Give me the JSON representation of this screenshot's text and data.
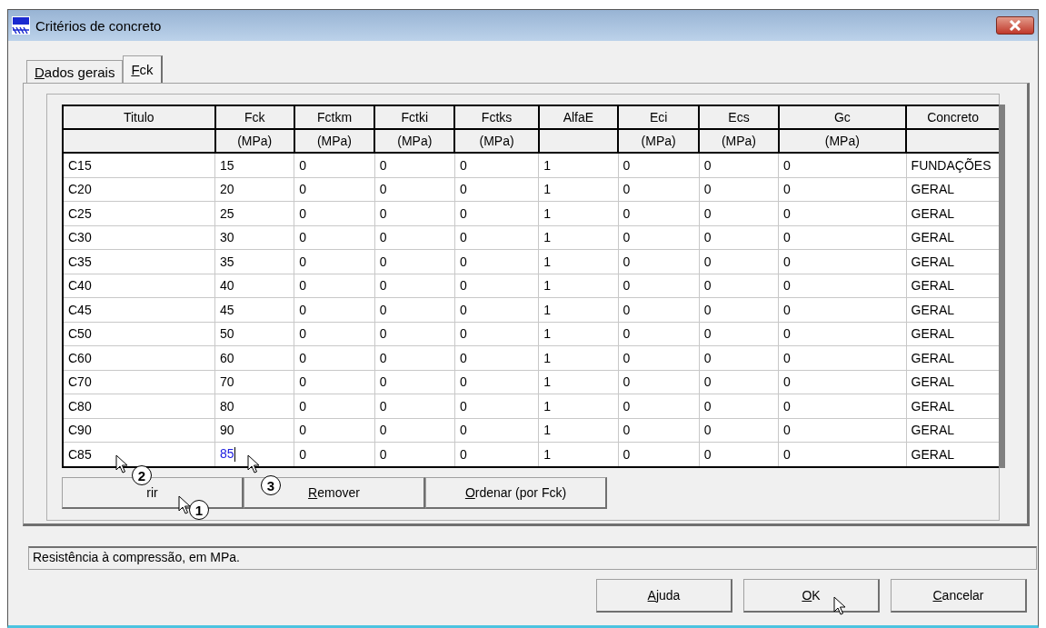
{
  "window": {
    "title": "Critérios de concreto"
  },
  "tabs": [
    {
      "label": "Dados gerais",
      "mnemonic": true,
      "selected": false
    },
    {
      "label": "Fck",
      "mnemonic": true,
      "selected": true
    }
  ],
  "table": {
    "columns": [
      {
        "title": "Titulo"
      },
      {
        "title": "Fck",
        "unit": "(MPa)"
      },
      {
        "title": "Fctkm",
        "unit": "(MPa)"
      },
      {
        "title": "Fctki",
        "unit": "(MPa)"
      },
      {
        "title": "Fctks",
        "unit": "(MPa)"
      },
      {
        "title": "AlfaE"
      },
      {
        "title": "Eci",
        "unit": "(MPa)"
      },
      {
        "title": "Ecs",
        "unit": "(MPa)"
      },
      {
        "title": "Gc",
        "unit": "(MPa)"
      },
      {
        "title": "Concreto"
      }
    ],
    "rows": [
      {
        "cells": [
          "C15",
          "15",
          "0",
          "0",
          "0",
          "1",
          "0",
          "0",
          "0",
          "FUNDAÇÕES"
        ],
        "editing": false
      },
      {
        "cells": [
          "C20",
          "20",
          "0",
          "0",
          "0",
          "1",
          "0",
          "0",
          "0",
          "GERAL"
        ],
        "editing": false
      },
      {
        "cells": [
          "C25",
          "25",
          "0",
          "0",
          "0",
          "1",
          "0",
          "0",
          "0",
          "GERAL"
        ],
        "editing": false
      },
      {
        "cells": [
          "C30",
          "30",
          "0",
          "0",
          "0",
          "1",
          "0",
          "0",
          "0",
          "GERAL"
        ],
        "editing": false
      },
      {
        "cells": [
          "C35",
          "35",
          "0",
          "0",
          "0",
          "1",
          "0",
          "0",
          "0",
          "GERAL"
        ],
        "editing": false
      },
      {
        "cells": [
          "C40",
          "40",
          "0",
          "0",
          "0",
          "1",
          "0",
          "0",
          "0",
          "GERAL"
        ],
        "editing": false
      },
      {
        "cells": [
          "C45",
          "45",
          "0",
          "0",
          "0",
          "1",
          "0",
          "0",
          "0",
          "GERAL"
        ],
        "editing": false
      },
      {
        "cells": [
          "C50",
          "50",
          "0",
          "0",
          "0",
          "1",
          "0",
          "0",
          "0",
          "GERAL"
        ],
        "editing": false
      },
      {
        "cells": [
          "C60",
          "60",
          "0",
          "0",
          "0",
          "1",
          "0",
          "0",
          "0",
          "GERAL"
        ],
        "editing": false
      },
      {
        "cells": [
          "C70",
          "70",
          "0",
          "0",
          "0",
          "1",
          "0",
          "0",
          "0",
          "GERAL"
        ],
        "editing": false
      },
      {
        "cells": [
          "C80",
          "80",
          "0",
          "0",
          "0",
          "1",
          "0",
          "0",
          "0",
          "GERAL"
        ],
        "editing": false
      },
      {
        "cells": [
          "C90",
          "90",
          "0",
          "0",
          "0",
          "1",
          "0",
          "0",
          "0",
          "GERAL"
        ],
        "editing": false
      },
      {
        "cells": [
          "C85",
          "85",
          "0",
          "0",
          "0",
          "1",
          "0",
          "0",
          "0",
          "GERAL"
        ],
        "editing": true
      }
    ]
  },
  "table_buttons": [
    {
      "label": "rir",
      "mnemonic": false
    },
    {
      "label": "Remover",
      "mnemonic": true
    },
    {
      "label": "Ordenar (por Fck)",
      "mnemonic": true
    }
  ],
  "status_bar": "Resistência à compressão, em MPa.",
  "dialog_buttons": [
    {
      "label": "Ajuda",
      "mnemonic": true
    },
    {
      "label": "OK",
      "mnemonic": true
    },
    {
      "label": "Cancelar",
      "mnemonic": true
    }
  ],
  "callouts": [
    "1",
    "2",
    "3"
  ]
}
